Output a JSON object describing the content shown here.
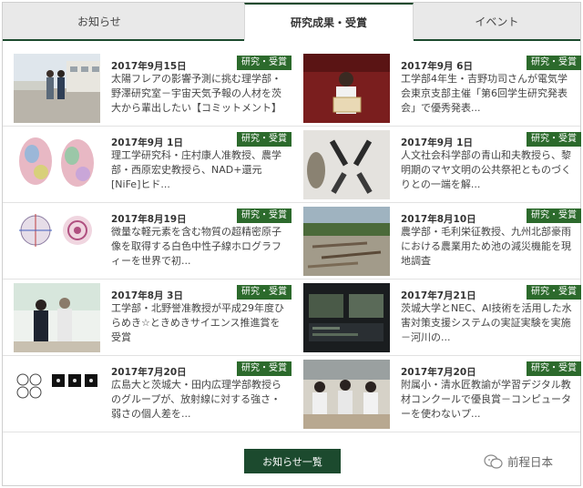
{
  "tabs": [
    {
      "label": "お知らせ"
    },
    {
      "label": "研究成果・受賞"
    },
    {
      "label": "イベント"
    }
  ],
  "colors": {
    "accent": "#1c4a2e",
    "badge": "#2c6a2c"
  },
  "items": [
    {
      "date": "2017年9月15日",
      "badge": "研究・受賞",
      "title": "太陽フレアの影響予測に挑む理学部・野澤研究室－宇宙天気予報の人材を茨大から輩出したい【コミットメント】",
      "thumb": "building-photo"
    },
    {
      "date": "2017年9月 6日",
      "badge": "研究・受賞",
      "title": "工学部4年生・吉野功司さんが電気学会東京支部主催「第6回学生研究発表会」で優秀発表...",
      "thumb": "award-photo"
    },
    {
      "date": "2017年9月 1日",
      "badge": "研究・受賞",
      "title": "理工学研究科・庄村康人准教授、農学部・西原宏史教授ら、NAD+還元[NiFe]ヒド...",
      "thumb": "protein-figure"
    },
    {
      "date": "2017年9月 1日",
      "badge": "研究・受賞",
      "title": "人文社会科学部の青山和夫教授ら、黎明期のマヤ文明の公共祭祀とものづくりとの一端を解...",
      "thumb": "artifacts-photo"
    },
    {
      "date": "2017年8月19日",
      "badge": "研究・受賞",
      "title": "微量な軽元素を含む物質の超精密原子像を取得する白色中性子線ホログラフィーを世界で初...",
      "thumb": "hologram-figure"
    },
    {
      "date": "2017年8月10日",
      "badge": "研究・受賞",
      "title": "農学部・毛利栄征教授、九州北部豪雨における農業用ため池の減災機能を現地調査",
      "thumb": "flood-photo"
    },
    {
      "date": "2017年8月 3日",
      "badge": "研究・受賞",
      "title": "工学部・北野誉准教授が平成29年度ひらめき☆ときめきサイエンス推進賞を受賞",
      "thumb": "ceremony-photo"
    },
    {
      "date": "2017年7月21日",
      "badge": "研究・受賞",
      "title": "茨城大学とNEC、AI技術を活用した水害対策支援システムの実証実験を実施－河川の...",
      "thumb": "monitor-photo"
    },
    {
      "date": "2017年7月20日",
      "badge": "研究・受賞",
      "title": "広島大と茨城大・田内広理学部教授らのグループが、放射線に対する強さ・弱さの個人差を...",
      "thumb": "cells-figure"
    },
    {
      "date": "2017年7月20日",
      "badge": "研究・受賞",
      "title": "附属小・清水匠教諭が学習デジタル教材コンクールで優良賞－コンピューターを使わないプ...",
      "thumb": "classroom-photo"
    }
  ],
  "more_button": "お知らせ一覧",
  "brand": "前程日本"
}
